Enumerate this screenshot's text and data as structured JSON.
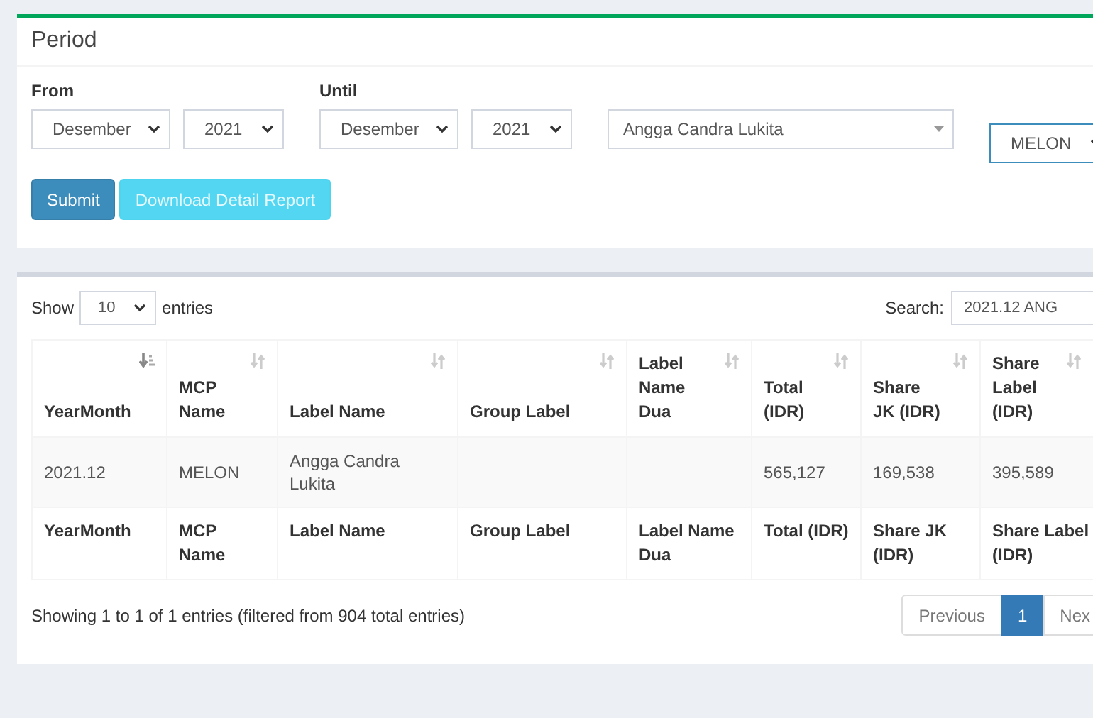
{
  "period_panel": {
    "title": "Period",
    "from": {
      "label": "From",
      "month": "Desember",
      "year": "2021"
    },
    "until": {
      "label": "Until",
      "month": "Desember",
      "year": "2021"
    },
    "artist": "Angga Candra Lukita",
    "platform": "MELON",
    "buttons": [
      {
        "label": "Submit",
        "kind": "primary"
      },
      {
        "label": "Download Detail Report",
        "kind": "info"
      }
    ]
  },
  "table_panel": {
    "length": {
      "before": "Show",
      "value": "10",
      "after": "entries"
    },
    "search": {
      "label": "Search:",
      "value": "2021.12 ANG"
    },
    "columns": [
      {
        "label": "YearMonth",
        "sorted": true
      },
      {
        "label": "MCP Name",
        "sorted": false
      },
      {
        "label": "Label Name",
        "sorted": false
      },
      {
        "label": "Group Label",
        "sorted": false
      },
      {
        "label": "Label Name Dua",
        "sorted": false
      },
      {
        "label": "Total (IDR)",
        "sorted": false
      },
      {
        "label": "Share JK (IDR)",
        "sorted": false
      },
      {
        "label": "Share Label (IDR)",
        "sorted": false
      }
    ],
    "rows": [
      [
        "2021.12",
        "MELON",
        "Angga Candra Lukita",
        "",
        "",
        "565,127",
        "169,538",
        "395,589"
      ]
    ],
    "footer": [
      "YearMonth",
      "MCP Name",
      "Label Name",
      "Group Label",
      "Label Name Dua",
      "Total (IDR)",
      "Share JK (IDR)",
      "Share Label (IDR)"
    ],
    "info": "Showing 1 to 1 of 1 entries (filtered from 904 total entries)",
    "pagination": [
      {
        "label": "Previous",
        "selected": false
      },
      {
        "label": "1",
        "selected": true
      },
      {
        "label": "Nex",
        "selected": false
      }
    ]
  }
}
